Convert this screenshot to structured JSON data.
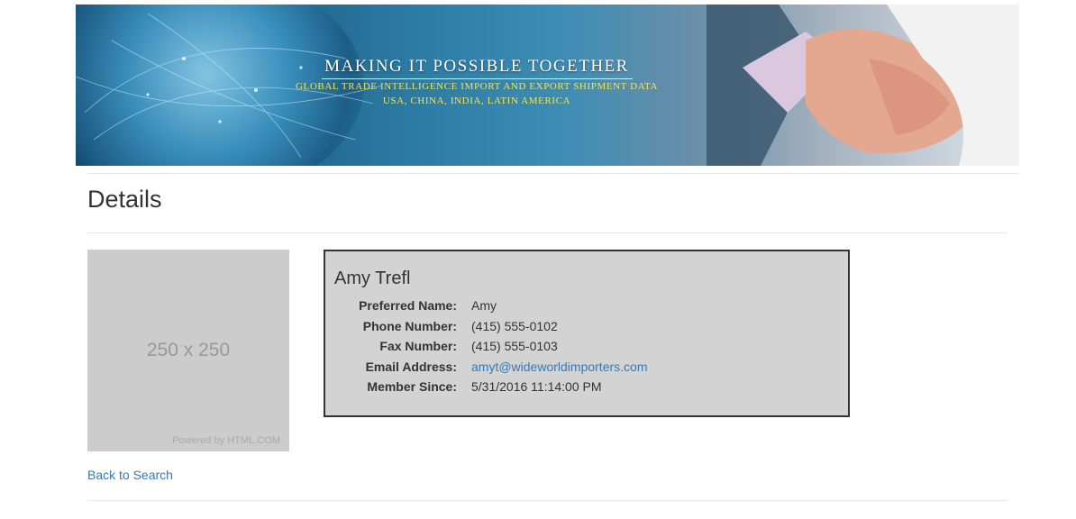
{
  "banner": {
    "headline": "MAKING IT POSSIBLE TOGETHER",
    "subline1": "GLOBAL TRADE INTELLIGENCE IMPORT AND EXPORT SHIPMENT DATA",
    "subline2": "USA, CHINA, INDIA, LATIN AMERICA"
  },
  "page": {
    "title": "Details"
  },
  "placeholder": {
    "size_label": "250 x 250",
    "powered_label": "Powered by HTML.COM"
  },
  "person": {
    "name": "Amy Trefl",
    "fields": [
      {
        "label": "Preferred Name:",
        "value": "Amy"
      },
      {
        "label": "Phone Number:",
        "value": "(415) 555-0102"
      },
      {
        "label": "Fax Number:",
        "value": "(415) 555-0103"
      },
      {
        "label": "Email Address:",
        "value": "amyt@wideworldimporters.com"
      },
      {
        "label": "Member Since:",
        "value": "5/31/2016 11:14:00 PM"
      }
    ]
  },
  "nav": {
    "back_label": "Back to Search"
  },
  "colors": {
    "link": "#337ab7",
    "card_bg": "#d3d3d3",
    "tag_yellow": "#f5e35a"
  }
}
